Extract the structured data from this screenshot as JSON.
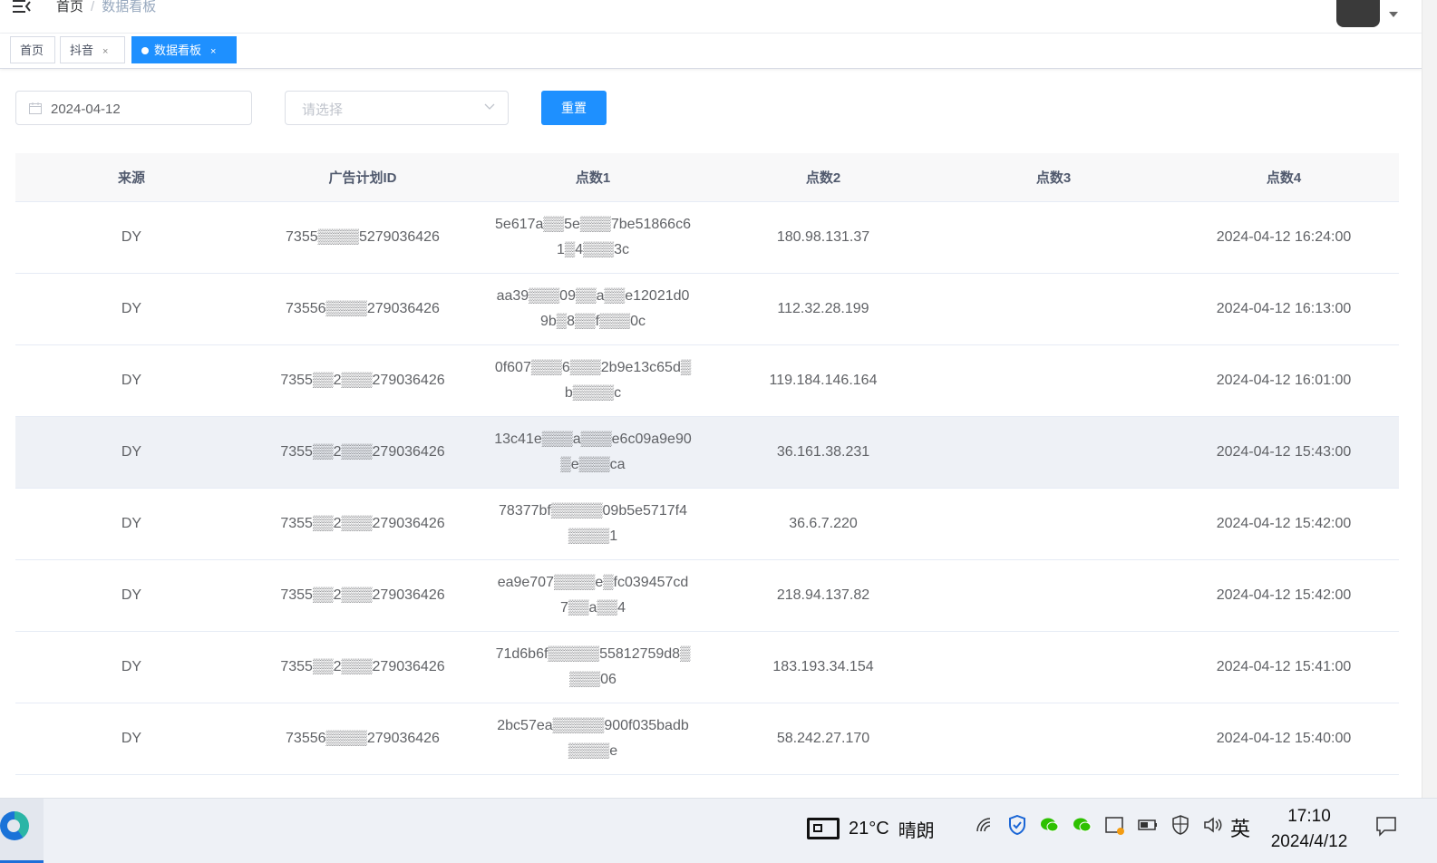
{
  "navbar": {
    "breadcrumb": [
      "首页",
      "/",
      "数据看板"
    ]
  },
  "tags": [
    {
      "label": "首页",
      "closable": false,
      "active": false
    },
    {
      "label": "抖音",
      "closable": true,
      "active": false
    },
    {
      "label": "数据看板",
      "closable": true,
      "active": true
    }
  ],
  "tag_close_glyph": "×",
  "filters": {
    "date_value": "2024-04-12",
    "select_placeholder": "请选择",
    "reset_label": "重置"
  },
  "table": {
    "columns": [
      "来源",
      "广告计划ID",
      "点数1",
      "点数2",
      "点数3",
      "点数4"
    ],
    "rows": [
      {
        "source": "DY",
        "plan_id": "7355▒▒▒▒5279036426",
        "p1": "5e617a▒▒5e▒▒▒7be51866c61▒4▒▒▒3c",
        "p2": "180.98.131.37",
        "p3": "",
        "p4": "2024-04-12 16:24:00"
      },
      {
        "source": "DY",
        "plan_id": "73556▒▒▒▒279036426",
        "p1": "aa39▒▒▒09▒▒a▒▒e12021d09b▒8▒▒f▒▒▒0c",
        "p2": "112.32.28.199",
        "p3": "",
        "p4": "2024-04-12 16:13:00"
      },
      {
        "source": "DY",
        "plan_id": "7355▒▒2▒▒▒279036426",
        "p1": "0f607▒▒▒6▒▒▒2b9e13c65d▒b▒▒▒▒c",
        "p2": "119.184.146.164",
        "p3": "",
        "p4": "2024-04-12 16:01:00"
      },
      {
        "source": "DY",
        "plan_id": "7355▒▒2▒▒▒279036426",
        "p1": "13c41e▒▒▒a▒▒▒e6c09a9e90▒e▒▒▒ca",
        "p2": "36.161.38.231",
        "p3": "",
        "p4": "2024-04-12 15:43:00"
      },
      {
        "source": "DY",
        "plan_id": "7355▒▒2▒▒▒279036426",
        "p1": "78377bf▒▒▒▒▒09b5e5717f4▒▒▒▒1",
        "p2": "36.6.7.220",
        "p3": "",
        "p4": "2024-04-12 15:42:00"
      },
      {
        "source": "DY",
        "plan_id": "7355▒▒2▒▒▒279036426",
        "p1": "ea9e707▒▒▒▒e▒fc039457cd7▒▒a▒▒4",
        "p2": "218.94.137.82",
        "p3": "",
        "p4": "2024-04-12 15:42:00"
      },
      {
        "source": "DY",
        "plan_id": "7355▒▒2▒▒▒279036426",
        "p1": "71d6b6f▒▒▒▒▒55812759d8▒▒▒▒06",
        "p2": "183.193.34.154",
        "p3": "",
        "p4": "2024-04-12 15:41:00"
      },
      {
        "source": "DY",
        "plan_id": "73556▒▒▒▒279036426",
        "p1": "2bc57ea▒▒▒▒▒900f035badb▒▒▒▒e",
        "p2": "58.242.27.170",
        "p3": "",
        "p4": "2024-04-12 15:40:00"
      },
      {
        "source": "",
        "plan_id": "",
        "p1": "",
        "p2": "",
        "p3": "",
        "p4": ""
      }
    ],
    "hover_row_index": 3
  },
  "taskbar": {
    "temperature": "21°C",
    "weather": "晴朗",
    "ime": "英",
    "time": "17:10",
    "date": "2024/4/12",
    "tray_icons": [
      "wifi-icon",
      "shield-icon",
      "wechat-icon",
      "wechat-icon",
      "sync-icon",
      "battery-icon",
      "security-icon",
      "volume-icon"
    ]
  },
  "colors": {
    "primary": "#1e90ff",
    "header_bg": "#f8f8f9",
    "hover_row": "#eef1f6",
    "taskbar_bg": "#eef1f6"
  }
}
